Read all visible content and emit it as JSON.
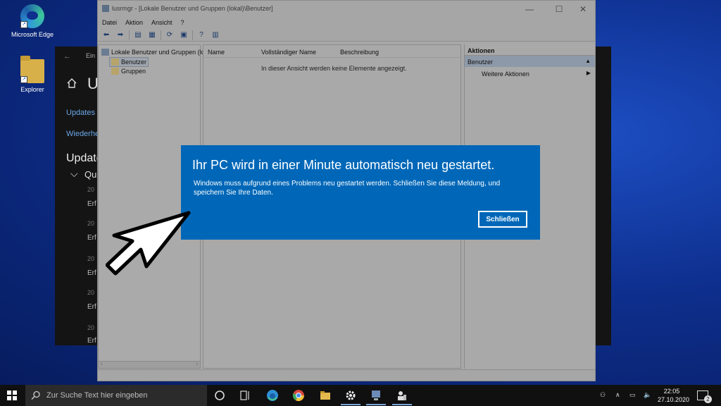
{
  "desktop": {
    "icons": [
      {
        "label": "Microsoft Edge",
        "icon": "edge-icon"
      },
      {
        "label": "Explorer",
        "icon": "folder-icon"
      }
    ]
  },
  "settings_window": {
    "nav_title": "Ein",
    "header_letter": "U",
    "links": [
      "Updates",
      "Wiederhe"
    ],
    "section_title": "Update",
    "group_label": "Qu",
    "year_labels": [
      "20",
      "20",
      "20",
      "20",
      "20"
    ],
    "entry_labels": [
      "Erf",
      "Erf",
      "Erf",
      "Erf",
      "Erf"
    ]
  },
  "mmc": {
    "title": "lusrmgr - [Lokale Benutzer und Gruppen (lokal)\\Benutzer]",
    "menu": [
      "Datei",
      "Aktion",
      "Ansicht",
      "?"
    ],
    "tree": {
      "root": "Lokale Benutzer und Gruppen (lo",
      "children": [
        "Benutzer",
        "Gruppen"
      ],
      "selected": "Benutzer"
    },
    "list": {
      "columns": [
        "Name",
        "Vollständiger Name",
        "Beschreibung"
      ],
      "empty_text": "In dieser Ansicht werden keine Elemente angezeigt."
    },
    "actions": {
      "header": "Aktionen",
      "group": "Benutzer",
      "items": [
        "Weitere Aktionen"
      ]
    }
  },
  "dialog": {
    "title": "Ihr PC wird in einer Minute automatisch neu gestartet.",
    "message": "Windows muss aufgrund eines Problems neu gestartet werden. Schließen Sie diese Meldung, und speichern Sie Ihre Daten.",
    "button": "Schließen",
    "background": "#0067b8"
  },
  "taskbar": {
    "search_placeholder": "Zur Suche Text hier eingeben",
    "pinned": [
      "task-view-icon",
      "edge-icon",
      "chrome-icon",
      "file-explorer-icon",
      "settings-icon",
      "computer-management-icon",
      "local-users-icon"
    ],
    "time": "22:05",
    "date": "27.10.2020",
    "notification_count": "2"
  }
}
